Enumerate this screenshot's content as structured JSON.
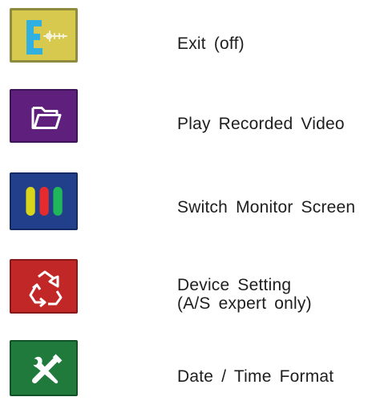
{
  "items": [
    {
      "id": "exit",
      "icon": "exit-icon",
      "label": "Exit (off)",
      "tile_color": "#d6c94e"
    },
    {
      "id": "play",
      "icon": "folder-icon",
      "label": "Play Recorded Video",
      "tile_color": "#5f1f7d"
    },
    {
      "id": "switch",
      "icon": "monitor-bars-icon",
      "label": "Switch Monitor Screen",
      "tile_color": "#213f8a"
    },
    {
      "id": "device",
      "icon": "recycle-icon",
      "label_line1": "Device Setting",
      "label_line2": "(A/S expert only)",
      "tile_color": "#c02726"
    },
    {
      "id": "date",
      "icon": "tools-icon",
      "label": "Date / Time Format",
      "tile_color": "#1f7a3b"
    }
  ]
}
